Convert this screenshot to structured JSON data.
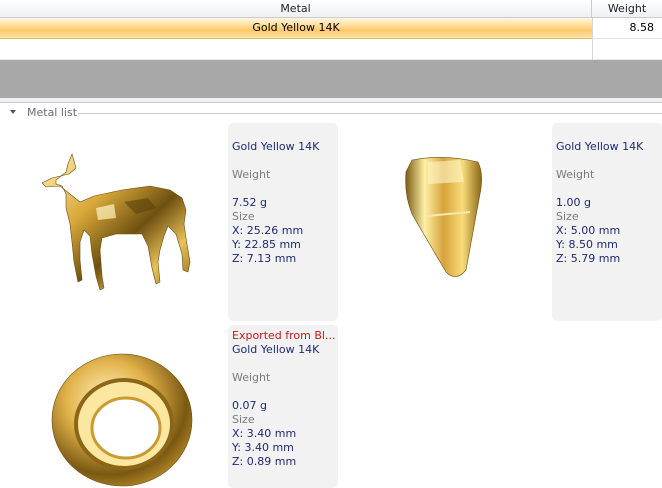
{
  "table": {
    "columns": {
      "metal": "Metal",
      "weight": "Weight"
    },
    "rows": [
      {
        "metal": "Gold Yellow 14K",
        "weight": "8.58"
      }
    ]
  },
  "group": {
    "label": "Metal list"
  },
  "items": [
    {
      "image": "deer-figurine",
      "exported": "",
      "metal": "Gold Yellow 14K",
      "weight_label": "Weight",
      "weight": "7.52 g",
      "size_label": "Size",
      "x": "X: 25.26 mm",
      "y": "Y: 22.85 mm",
      "z": "Z: 7.13 mm"
    },
    {
      "image": "pendant-bail",
      "exported": "",
      "metal": "Gold Yellow 14K",
      "weight_label": "Weight",
      "weight": "1.00 g",
      "size_label": "Size",
      "x": "X: 5.00 mm",
      "y": "Y: 8.50 mm",
      "z": "Z: 5.79 mm"
    },
    {
      "image": "jump-ring",
      "exported": "Exported from Bl...",
      "metal": "Gold Yellow 14K",
      "weight_label": "Weight",
      "weight": "0.07 g",
      "size_label": "Size",
      "x": "X: 3.40 mm",
      "y": "Y: 3.40 mm",
      "z": "Z: 0.89 mm"
    }
  ],
  "colors": {
    "selected_row": "#ffc86a",
    "metal_text": "#1e2a74",
    "exported_text": "#c81818"
  }
}
